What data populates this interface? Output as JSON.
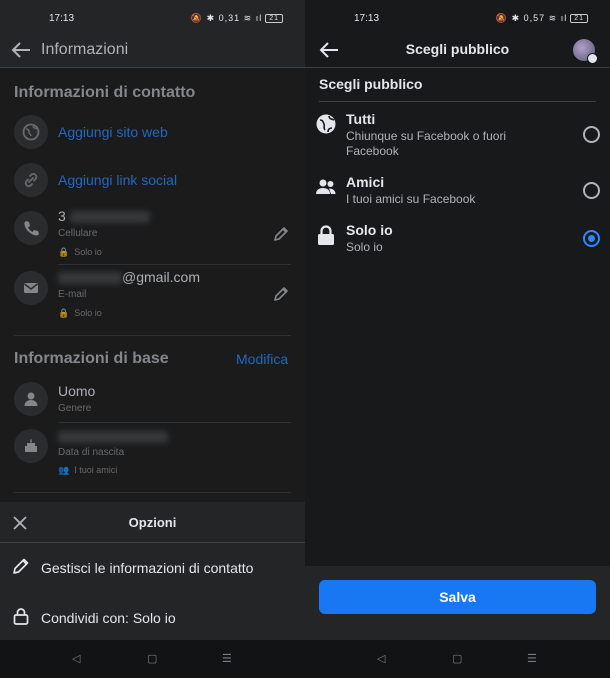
{
  "left": {
    "status": {
      "time": "17:13",
      "icons": "🔕 ✱ 0,31 ≋ ıl",
      "battery": "21"
    },
    "header": {
      "title": "Informazioni"
    },
    "contact": {
      "title": "Informazioni di contatto",
      "add_website": "Aggiungi sito web",
      "add_social": "Aggiungi link social",
      "phone_prefix": "3",
      "phone_label": "Cellulare",
      "phone_privacy": "Solo io",
      "email_suffix": "@gmail.com",
      "email_label": "E-mail",
      "email_privacy": "Solo io"
    },
    "basic": {
      "title": "Informazioni di base",
      "edit": "Modifica",
      "gender_value": "Uomo",
      "gender_label": "Genere",
      "birth_label": "Data di nascita",
      "birth_privacy": "I tuoi amici"
    },
    "sheet": {
      "title": "Opzioni",
      "item1": "Gestisci le informazioni di contatto",
      "item2": "Condividi con: Solo io"
    },
    "nav": {
      "back": "◁",
      "home": "▢",
      "menu": "☰"
    }
  },
  "right": {
    "status": {
      "time": "17:13",
      "icons": "🔕 ✱ 0,57 ≋ ıl",
      "battery": "21"
    },
    "header": {
      "title": "Scegli pubblico"
    },
    "subtitle": "Scegli pubblico",
    "options": [
      {
        "title": "Tutti",
        "desc": "Chiunque su Facebook o fuori Facebook",
        "selected": false
      },
      {
        "title": "Amici",
        "desc": "I tuoi amici su Facebook",
        "selected": false
      },
      {
        "title": "Solo io",
        "desc": "Solo io",
        "selected": true
      }
    ],
    "save": "Salva",
    "nav": {
      "back": "◁",
      "home": "▢",
      "menu": "☰"
    }
  },
  "colors": {
    "accent": "#2d88ff",
    "button": "#1877f2",
    "bg_dark": "#18191a",
    "bg_card": "#242526"
  }
}
